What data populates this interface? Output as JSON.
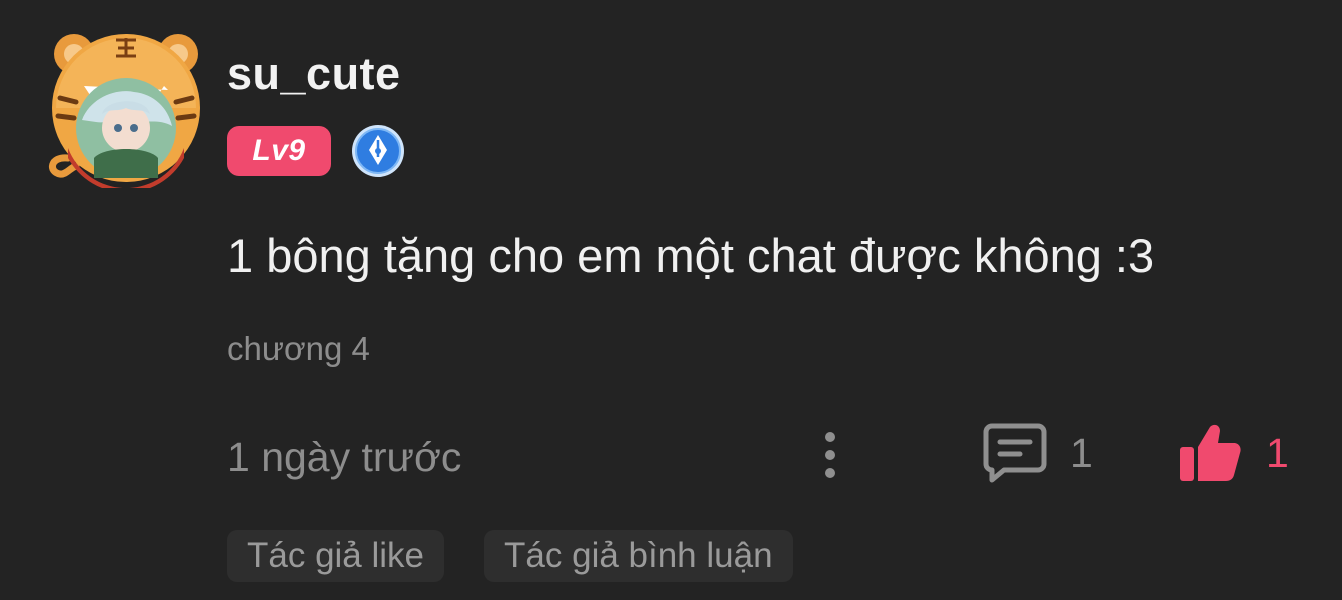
{
  "comment": {
    "username": "su_cute",
    "level_badge": "Lv9",
    "author_badge_icon": "quill-pen-icon",
    "avatar_icon": "tiger-hood-avatar",
    "text": "1 bông tặng cho em một chat được không :3",
    "chapter": "chương 4",
    "timestamp": "1 ngày trước",
    "more_icon": "more-vertical-icon",
    "reply": {
      "icon": "comment-bubble-icon",
      "count": "1"
    },
    "like": {
      "icon": "thumbs-up-icon",
      "count": "1",
      "liked": true
    },
    "tags": [
      {
        "label": "Tác giả like"
      },
      {
        "label": "Tác giả bình luận"
      }
    ]
  },
  "colors": {
    "background": "#232323",
    "accent": "#f04a6e",
    "muted_text": "#8d8d8d",
    "author_badge_blue": "#2f7de1"
  }
}
